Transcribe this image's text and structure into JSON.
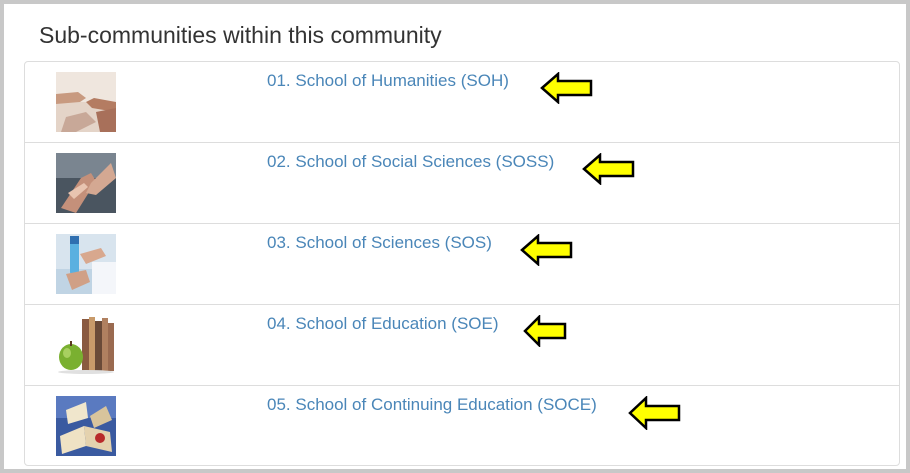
{
  "panel": {
    "title": "Sub-communities within this community"
  },
  "sub_communities": [
    {
      "label": "01. School of Humanities (SOH)",
      "thumbnail_icon": "hands-reaching-image"
    },
    {
      "label": "02. School of Social Sciences (SOSS)",
      "thumbnail_icon": "hands-touching-image"
    },
    {
      "label": "03. School of Sciences (SOS)",
      "thumbnail_icon": "test-tube-image"
    },
    {
      "label": "04. School of Education (SOE)",
      "thumbnail_icon": "apple-and-books-image"
    },
    {
      "label": "05. School of Continuing Education (SOCE)",
      "thumbnail_icon": "open-books-image"
    }
  ],
  "colors": {
    "link": "#4a86b8",
    "arrow_fill": "#ffff00",
    "arrow_stroke": "#000000",
    "frame_border": "#c8c8c8",
    "divider": "#dddddd"
  }
}
